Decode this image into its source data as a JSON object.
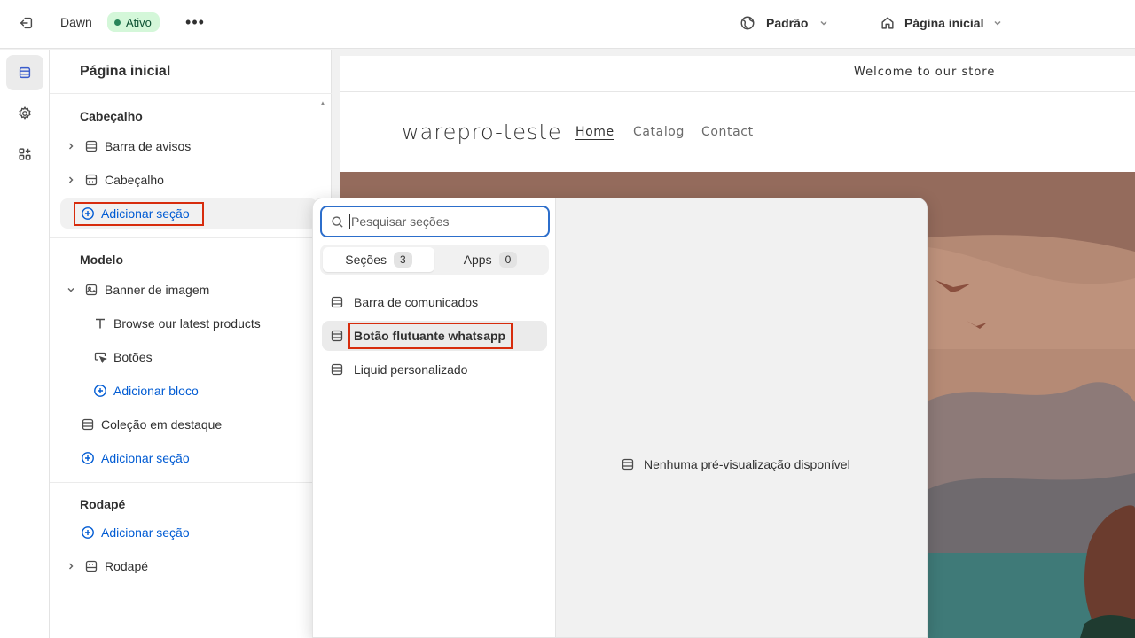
{
  "topbar": {
    "theme_name": "Dawn",
    "status_badge": "Ativo",
    "more_label": "•••",
    "locale_label": "Padrão",
    "page_label": "Página inicial"
  },
  "sidebar": {
    "title": "Página inicial",
    "groups": {
      "header": {
        "label": "Cabeçalho",
        "items": [
          {
            "label": "Barra de avisos",
            "icon": "section-icon"
          },
          {
            "label": "Cabeçalho",
            "icon": "header-section-icon"
          }
        ],
        "add_label": "Adicionar seção"
      },
      "template": {
        "label": "Modelo",
        "banner": {
          "label": "Banner de imagem",
          "icon": "image-section-icon"
        },
        "blocks": [
          {
            "label": "Browse our latest products",
            "icon": "text-icon"
          },
          {
            "label": "Botões",
            "icon": "button-pointer-icon"
          }
        ],
        "add_block_label": "Adicionar bloco",
        "collection": {
          "label": "Coleção em destaque",
          "icon": "section-icon"
        },
        "add_label": "Adicionar seção"
      },
      "footer": {
        "label": "Rodapé",
        "add_label": "Adicionar seção",
        "item": {
          "label": "Rodapé",
          "icon": "footer-section-icon"
        }
      }
    }
  },
  "popover": {
    "search": {
      "placeholder": "Pesquisar seções",
      "value": ""
    },
    "tabs": [
      {
        "label": "Seções",
        "count": "3",
        "active": true
      },
      {
        "label": "Apps",
        "count": "0",
        "active": false
      }
    ],
    "sections": [
      {
        "label": "Barra de comunicados"
      },
      {
        "label": "Botão flutuante whatsapp"
      },
      {
        "label": "Liquid personalizado"
      }
    ],
    "no_preview": "Nenhuma pré-visualização disponível"
  },
  "preview": {
    "announcement": "Welcome to our store",
    "store_name": "warepro-teste",
    "nav": [
      "Home",
      "Catalog",
      "Contact"
    ]
  },
  "colors": {
    "accent_blue": "#005bd3",
    "focus_blue": "#2c6ecb",
    "badge_bg": "#d4f7d9",
    "badge_text": "#0c5132",
    "highlight_red": "#d72c0d"
  }
}
